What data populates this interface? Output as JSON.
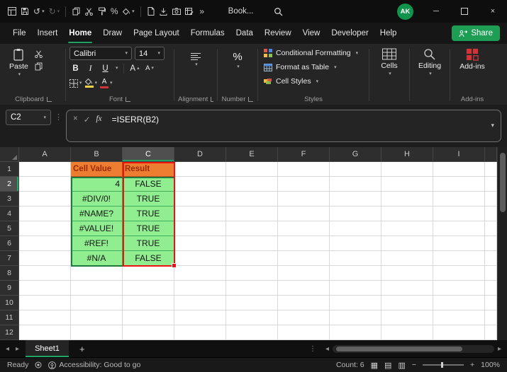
{
  "colors": {
    "accent": "#21A366",
    "header_fill": "#ED7D31",
    "header_text": "#9C2B00",
    "header_border": "#BF4F1F",
    "value_fill": "#90EE90",
    "value_border": "#3FAE5C",
    "range_green": "#1F7A3D",
    "range_red": "#EE1111",
    "share_bg": "#1D9E54",
    "avatar_bg": "#12934B",
    "fill_swatch": "#FFD24C",
    "font_swatch": "#D13438"
  },
  "titlebar": {
    "title": "Book...",
    "avatar_initials": "AK"
  },
  "ribbon": {
    "tabs": [
      "File",
      "Insert",
      "Home",
      "Draw",
      "Page Layout",
      "Formulas",
      "Data",
      "Review",
      "View",
      "Developer",
      "Help"
    ],
    "active_tab": "Home",
    "share_label": "Share",
    "clipboard": {
      "label": "Clipboard",
      "paste_label": "Paste"
    },
    "font": {
      "label": "Font",
      "family": "Calibri",
      "size": "14",
      "bold": "B",
      "italic": "I",
      "underline": "U",
      "grow": "A",
      "shrink": "A",
      "color_letter": "A"
    },
    "alignment": {
      "label": "Alignment"
    },
    "number": {
      "label": "Number"
    },
    "styles": {
      "label": "Styles",
      "conditional_formatting": "Conditional Formatting",
      "format_as_table": "Format as Table",
      "cell_styles": "Cell Styles"
    },
    "cells": {
      "label": "Cells"
    },
    "editing": {
      "label": "Editing"
    },
    "addins": {
      "label": "Add-ins"
    }
  },
  "formula_bar": {
    "name_box": "C2",
    "formula": "=ISERR(B2)"
  },
  "grid": {
    "columns": [
      "A",
      "B",
      "C",
      "D",
      "E",
      "F",
      "G",
      "H",
      "I"
    ],
    "rows": [
      "1",
      "2",
      "3",
      "4",
      "5",
      "6",
      "7",
      "8",
      "9",
      "10",
      "11",
      "12"
    ]
  },
  "sheet": {
    "header_value": "Cell Value",
    "header_result": "Result",
    "data": [
      {
        "value": "4",
        "result": "FALSE"
      },
      {
        "value": "#DIV/0!",
        "result": "TRUE"
      },
      {
        "value": "#NAME?",
        "result": "TRUE"
      },
      {
        "value": "#VALUE!",
        "result": "TRUE"
      },
      {
        "value": "#REF!",
        "result": "TRUE"
      },
      {
        "value": "#N/A",
        "result": "FALSE"
      }
    ]
  },
  "sheet_tabs": {
    "active": "Sheet1"
  },
  "status": {
    "mode": "Ready",
    "accessibility": "Accessibility: Good to go",
    "count": "Count: 6",
    "zoom": "100%"
  },
  "glyphs": {
    "chevron_down": "▾",
    "chevron_up": "▴",
    "undo": "↺",
    "redo": "↻",
    "more_commands": "»",
    "vertical_dots": "⋮",
    "cancel": "×",
    "enter": "✓",
    "fx": "fx",
    "percent": "%",
    "minimize": "─",
    "close": "×",
    "plus": "+",
    "minus": "−",
    "scroll_left": "◂",
    "scroll_right": "▸",
    "normal_view": "▦",
    "page_layout_view": "▤",
    "page_break_view": "▥",
    "add_sheet": "+"
  }
}
